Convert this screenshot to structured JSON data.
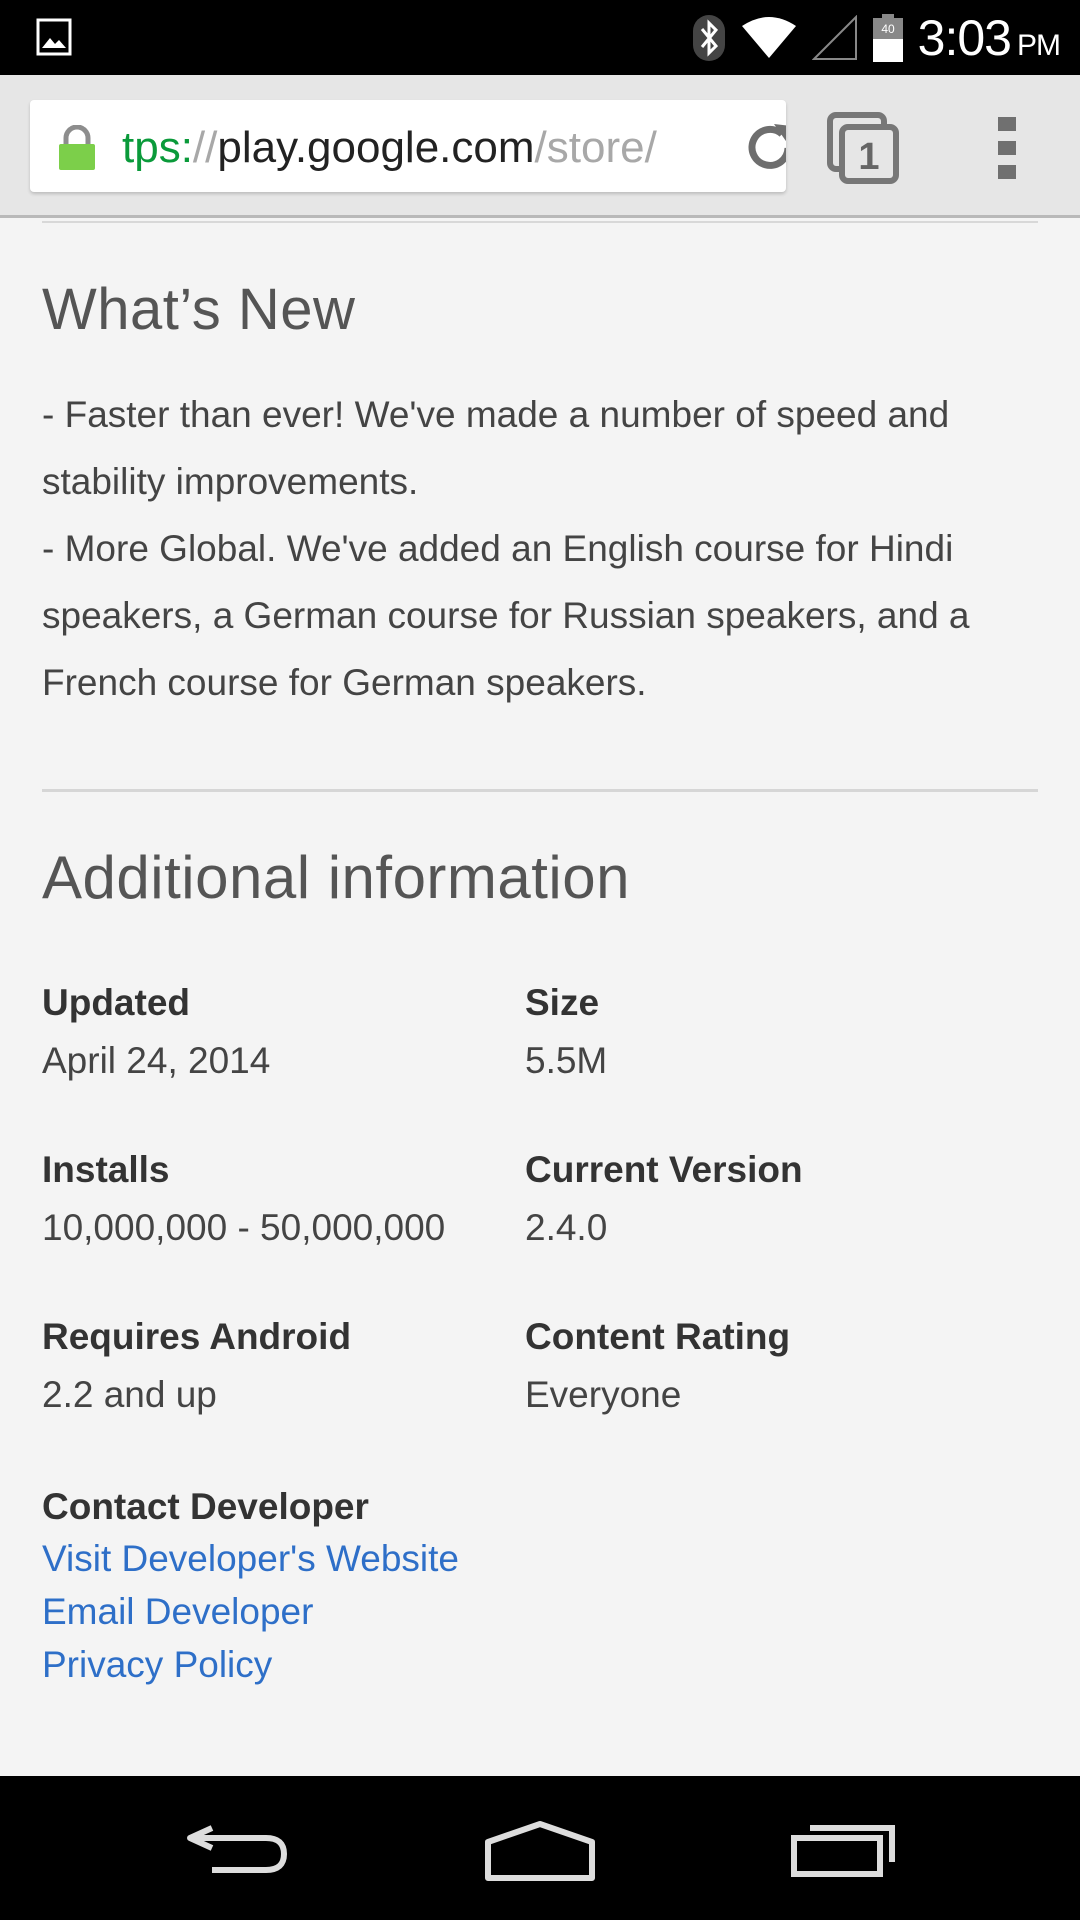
{
  "status_bar": {
    "time": "3:03",
    "ampm": "PM",
    "battery_level": "40",
    "icons": [
      "image-notification-icon",
      "bluetooth-icon",
      "wifi-icon",
      "cell-signal-icon",
      "battery-icon"
    ]
  },
  "browser": {
    "url": {
      "scheme": "tps:",
      "slashes": "//",
      "host": "play.google.com",
      "path": "/store/"
    },
    "tab_count": "1"
  },
  "whats_new": {
    "title": "What’s New",
    "lines": [
      "- Faster than ever! We've made a number of speed and stability improvements.",
      "- More Global. We've added an English course for Hindi speakers, a German course for Russian speakers, and a French course for German speakers."
    ]
  },
  "additional_info": {
    "title": "Additional information",
    "updated": {
      "label": "Updated",
      "value": "April 24, 2014"
    },
    "size": {
      "label": "Size",
      "value": "5.5M"
    },
    "installs": {
      "label": "Installs",
      "value": "10,000,000 - 50,000,000"
    },
    "current_version": {
      "label": "Current Version",
      "value": "2.4.0"
    },
    "requires_android": {
      "label": "Requires Android",
      "value": "2.2 and up"
    },
    "content_rating": {
      "label": "Content Rating",
      "value": "Everyone"
    },
    "contact": {
      "label": "Contact Developer",
      "links": [
        "Visit Developer's Website",
        "Email Developer",
        "Privacy Policy"
      ]
    }
  },
  "colors": {
    "link": "#2e6fc8",
    "url_scheme": "#0a9a3a",
    "lock": "#7ccf4a",
    "background": "#f4f4f4"
  }
}
